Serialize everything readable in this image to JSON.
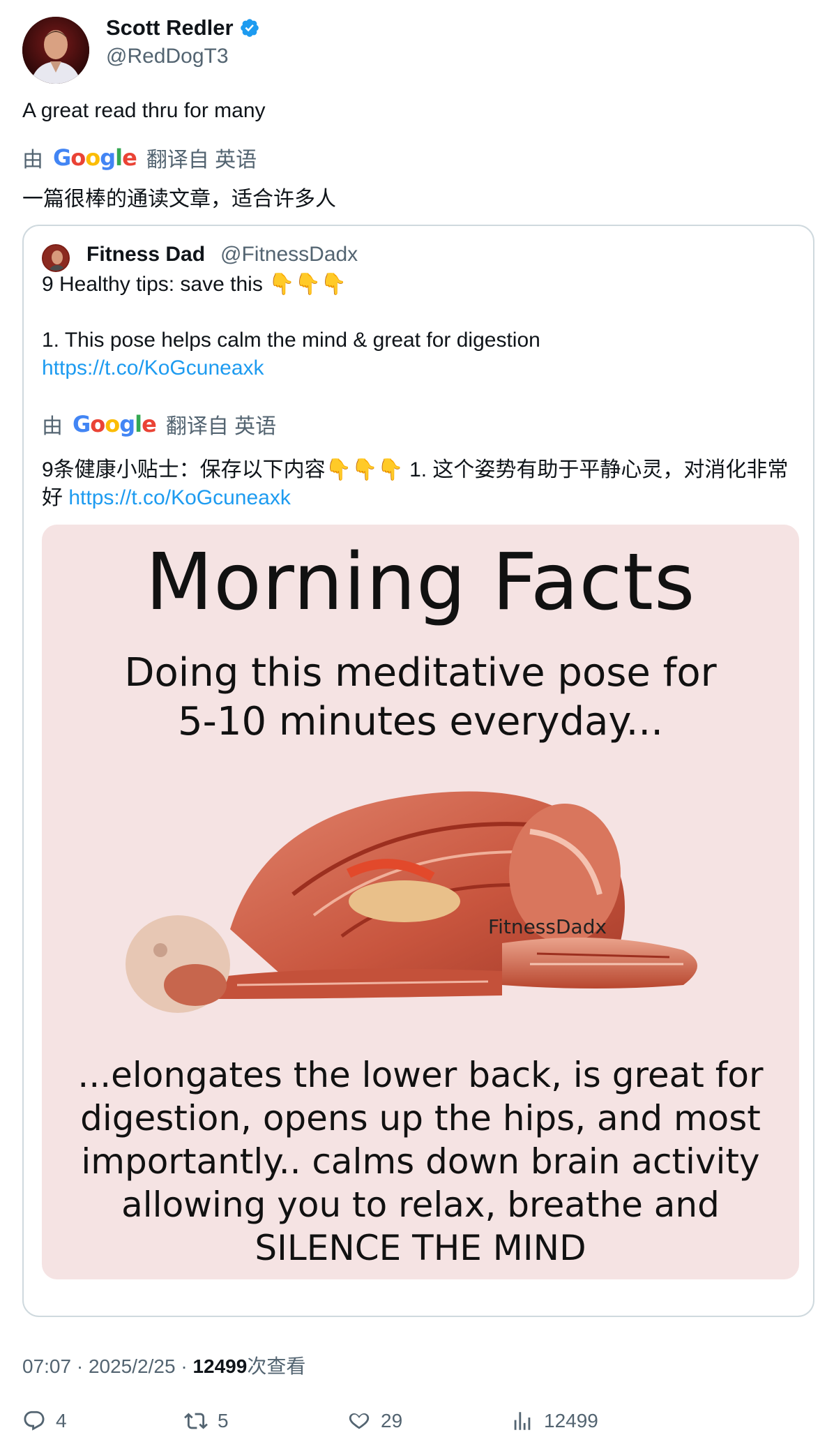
{
  "author": {
    "name": "Scott Redler",
    "handle": "@RedDogT3"
  },
  "tweet": {
    "text": "A great read thru for many",
    "translation_prefix": "由",
    "translation_suffix": "翻译自 英语",
    "translated_text": "一篇很棒的通读文章，适合许多人"
  },
  "quoted": {
    "name": "Fitness Dad",
    "handle": "@FitnessDadx",
    "line1": "9 Healthy tips: save this 👇👇👇",
    "line2": "1. This pose helps calm the mind & great for digestion",
    "link": "https://t.co/KoGcuneaxk",
    "translation_prefix": "由",
    "translation_suffix": "翻译自 英语",
    "translated_text": "9条健康小贴士：保存以下内容👇👇👇 1. 这个姿势有助于平静心灵，对消化非常好",
    "translated_link": "https://t.co/KoGcuneaxk",
    "media": {
      "title": "Morning Facts",
      "subtitle_line1": "Doing this meditative pose for",
      "subtitle_line2": "5-10 minutes everyday...",
      "watermark": "FitnessDadx",
      "body_line1": "...elongates the lower back, is great for",
      "body_line2": "digestion, opens up the hips, and most",
      "body_line3": "importantly.. calms down brain activity",
      "body_line4": "allowing you to relax, breathe and",
      "body_line5": "SILENCE THE MIND"
    }
  },
  "meta": {
    "time": "07:07",
    "date": "2025/2/25",
    "views": "12499",
    "views_label": "次查看"
  },
  "actions": {
    "replies": "4",
    "retweets": "5",
    "likes": "29",
    "views": "12499"
  },
  "colors": {
    "link": "#1d9bf0",
    "secondary": "#536471",
    "verified": "#1d9bf0",
    "media_bg": "#f5e3e3"
  },
  "icons": [
    "verified-icon",
    "google-logo",
    "reply-icon",
    "retweet-icon",
    "like-icon",
    "views-icon"
  ]
}
